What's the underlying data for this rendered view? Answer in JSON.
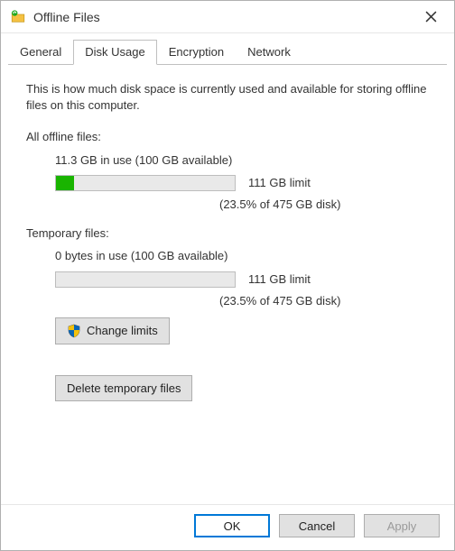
{
  "window": {
    "title": "Offline Files"
  },
  "tabs": {
    "general": "General",
    "disk_usage": "Disk Usage",
    "encryption": "Encryption",
    "network": "Network"
  },
  "content": {
    "intro": "This is how much disk space is currently used and available for storing offline files on this computer.",
    "all_label": "All offline files:",
    "all_usage": "11.3 GB in use (100 GB available)",
    "all_limit": "111 GB limit",
    "all_pct": "(23.5% of 475 GB disk)",
    "all_fill_percent": 10,
    "temp_label": "Temporary files:",
    "temp_usage": "0 bytes in use (100 GB available)",
    "temp_limit": "111 GB limit",
    "temp_pct": "(23.5% of 475 GB disk)",
    "temp_fill_percent": 0,
    "change_limits": "Change limits",
    "delete_temp": "Delete temporary files"
  },
  "buttons": {
    "ok": "OK",
    "cancel": "Cancel",
    "apply": "Apply"
  }
}
